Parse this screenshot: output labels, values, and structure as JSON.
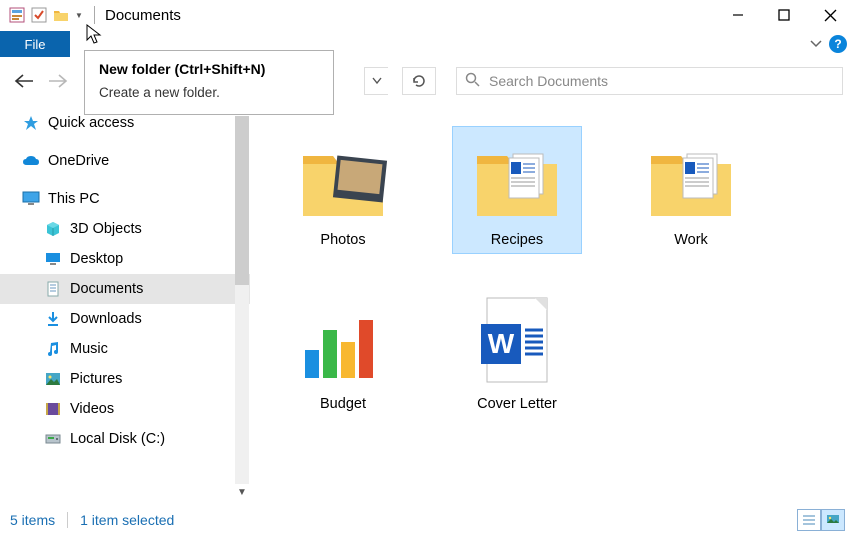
{
  "window": {
    "title": "Documents"
  },
  "ribbon": {
    "file_label": "File"
  },
  "tooltip": {
    "title": "New folder (Ctrl+Shift+N)",
    "description": "Create a new folder."
  },
  "search": {
    "placeholder": "Search Documents"
  },
  "sidebar": {
    "quick_access": "Quick access",
    "onedrive": "OneDrive",
    "this_pc": "This PC",
    "children": [
      {
        "label": "3D Objects",
        "icon": "cube3d"
      },
      {
        "label": "Desktop",
        "icon": "desktop"
      },
      {
        "label": "Documents",
        "icon": "document",
        "selected": true
      },
      {
        "label": "Downloads",
        "icon": "download"
      },
      {
        "label": "Music",
        "icon": "music"
      },
      {
        "label": "Pictures",
        "icon": "pictures"
      },
      {
        "label": "Videos",
        "icon": "videos"
      },
      {
        "label": "Local Disk (C:)",
        "icon": "disk"
      }
    ]
  },
  "content": {
    "items": [
      {
        "label": "Photos",
        "icon": "folder-photos",
        "selected": false
      },
      {
        "label": "Recipes",
        "icon": "folder-docs",
        "selected": true
      },
      {
        "label": "Work",
        "icon": "folder-docs",
        "selected": false
      },
      {
        "label": "Budget",
        "icon": "chart",
        "selected": false
      },
      {
        "label": "Cover Letter",
        "icon": "word",
        "selected": false
      }
    ]
  },
  "statusbar": {
    "count": "5 items",
    "selection": "1 item selected"
  }
}
